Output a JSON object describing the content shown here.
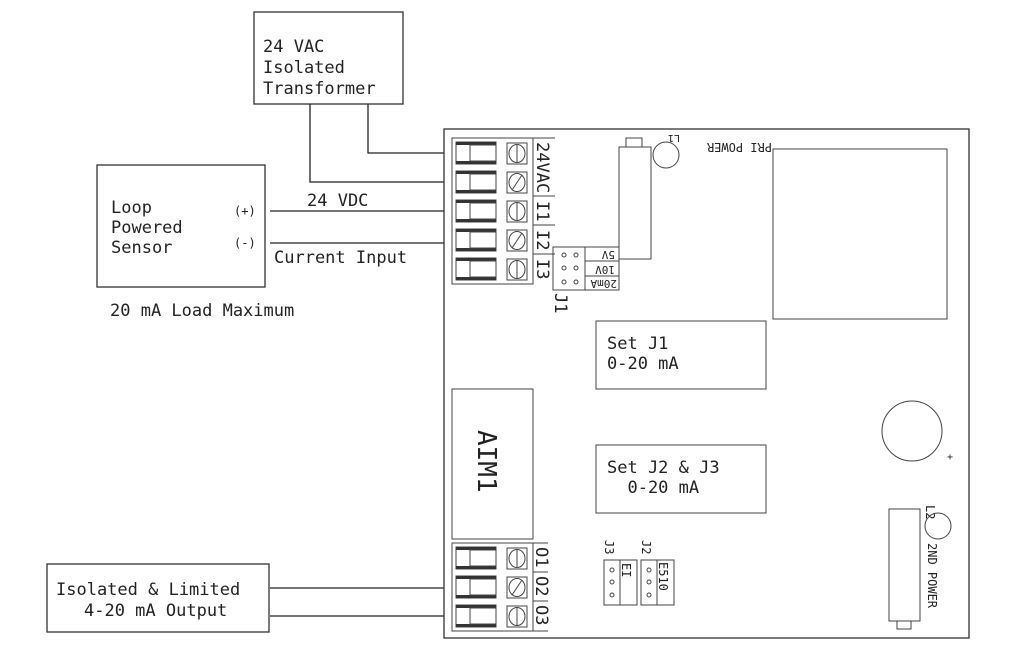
{
  "transformer": {
    "lines": [
      "24 VAC",
      "Isolated",
      "Transformer"
    ]
  },
  "sensor": {
    "lines": [
      "Loop",
      "Powered",
      "Sensor"
    ],
    "plus": "(+)",
    "minus": "(-)",
    "note": "20 mA Load Maximum"
  },
  "wires": {
    "vdc": "24 VDC",
    "current": "Current Input"
  },
  "output_box": {
    "lines": [
      "Isolated & Limited",
      "4-20 mA Output"
    ]
  },
  "input_terminals": [
    "24VAC",
    "I1",
    "I2",
    "I3"
  ],
  "output_terminals": [
    "O1",
    "O2",
    "O3"
  ],
  "j1": {
    "label": "J1",
    "options": [
      "5V",
      "10V",
      "20mA"
    ]
  },
  "j2": {
    "label": "J2",
    "marks": "E510"
  },
  "j3": {
    "label": "J3",
    "marks": "EI"
  },
  "led1": {
    "label": "PRI POWER",
    "id": "L1"
  },
  "led2": {
    "label": "2ND POWER",
    "id": "L2"
  },
  "note_j1": {
    "lines": [
      "Set J1",
      "0-20 mA"
    ]
  },
  "note_j23": {
    "lines": [
      "Set J2 & J3",
      "  0-20 mA"
    ]
  },
  "module": {
    "label": "AIM1"
  },
  "capacitor": {
    "polarity": "+"
  }
}
